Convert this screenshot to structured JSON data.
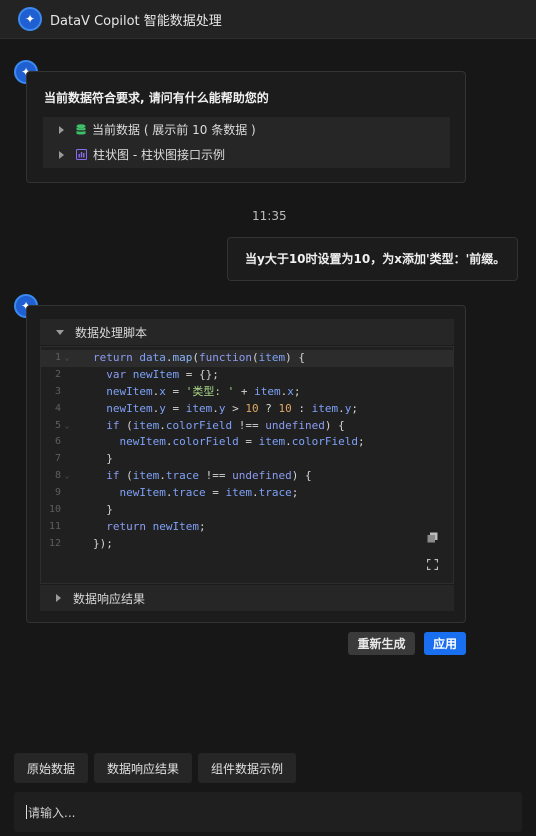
{
  "header": {
    "title": "DataV Copilot 智能数据处理",
    "avatar_icon": "sparkle-icon"
  },
  "message1": {
    "text": "当前数据符合要求, 请问有什么能帮助您的",
    "items": [
      {
        "label": "当前数据 ( 展示前 10 条数据 )",
        "icon": "database-icon",
        "icon_color": "#3fbf6a"
      },
      {
        "label": "柱状图 - 柱状图接口示例",
        "icon": "chart-component-icon",
        "icon_color": "#8a6cf0"
      }
    ]
  },
  "timestamp": "11:35",
  "user_message": "当y大于10时设置为10，为x添加'类型：'前缀。",
  "message2": {
    "script_section_label": "数据处理脚本",
    "result_section_label": "数据响应结果",
    "code_line_numbers": [
      "1",
      "2",
      "3",
      "4",
      "5",
      "6",
      "7",
      "8",
      "9",
      "10",
      "11",
      "12"
    ],
    "code_text": "return data.map(function(item) {\n  var newItem = {};\n  newItem.x = '类型: ' + item.x;\n  newItem.y = item.y > 10 ? 10 : item.y;\n  if (item.colorField !== undefined) {\n    newItem.colorField = item.colorField;\n  }\n  if (item.trace !== undefined) {\n    newItem.trace = item.trace;\n  }\n  return newItem;\n});"
  },
  "actions": {
    "regenerate": "重新生成",
    "apply": "应用"
  },
  "quick_tabs": [
    "原始数据",
    "数据响应结果",
    "组件数据示例"
  ],
  "input": {
    "placeholder": "请输入..."
  },
  "colors": {
    "accent": "#1a6ef0",
    "background": "#171717",
    "card": "#1c1c1c"
  }
}
